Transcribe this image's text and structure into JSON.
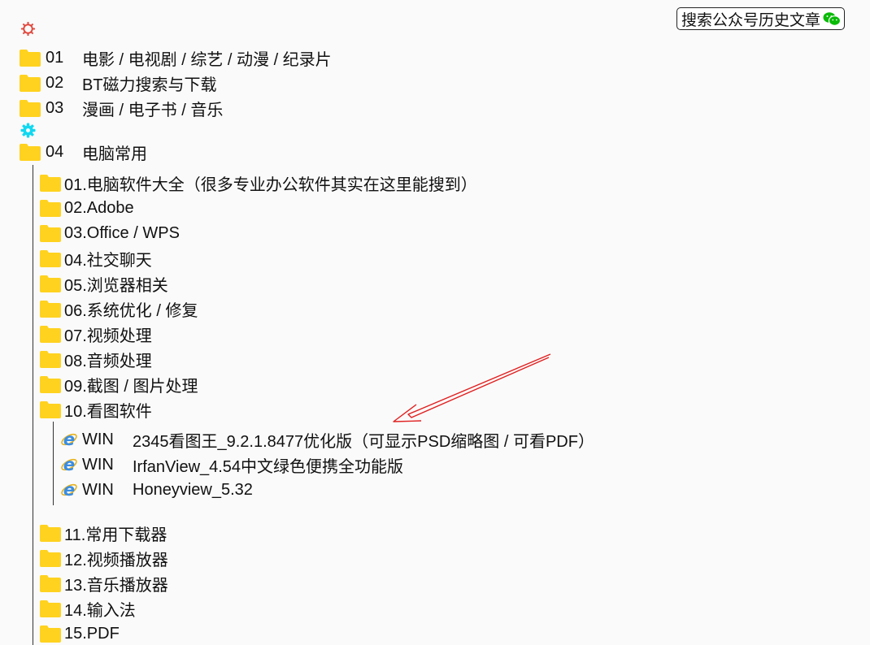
{
  "header": {
    "search_label": "搜索公众号历史文章",
    "wechat_icon": "wechat-icon",
    "gear_icon_top": "gear-icon",
    "gear_icon_mid": "gear-icon"
  },
  "colors": {
    "folder": "#ffd21f",
    "gear_red": "#e0463b",
    "gear_cyan": "#12d8f0",
    "wechat": "#09bb07",
    "ie_blue": "#3b8de0",
    "arrow": "#e02020"
  },
  "top_folders": [
    {
      "num": "01",
      "label": "电影 / 电视剧 / 综艺 / 动漫 / 纪录片"
    },
    {
      "num": "02",
      "label": "BT磁力搜索与下载"
    },
    {
      "num": "03",
      "label": "漫画 / 电子书 / 音乐"
    },
    {
      "num": "04",
      "label": "电脑常用"
    }
  ],
  "sub_folders": [
    {
      "label": "01.电脑软件大全（很多专业办公软件其实在这里能搜到）"
    },
    {
      "label": "02.Adobe"
    },
    {
      "label": "03.Office / WPS"
    },
    {
      "label": "04.社交聊天"
    },
    {
      "label": "05.浏览器相关"
    },
    {
      "label": "06.系统优化 / 修复"
    },
    {
      "label": "07.视频处理"
    },
    {
      "label": "08.音频处理"
    },
    {
      "label": "09.截图 / 图片处理"
    },
    {
      "label": "10.看图软件"
    },
    {
      "label": "11.常用下载器"
    },
    {
      "label": "12.视频播放器"
    },
    {
      "label": "13.音乐播放器"
    },
    {
      "label": "14.输入法"
    },
    {
      "label": "15.PDF"
    }
  ],
  "files": [
    {
      "platform": "WIN",
      "label": "2345看图王_9.2.1.8477优化版（可显示PSD缩略图 / 可看PDF）"
    },
    {
      "platform": "WIN",
      "label": "IrfanView_4.54中文绿色便携全功能版"
    },
    {
      "platform": "WIN",
      "label": "Honeyview_5.32"
    }
  ]
}
